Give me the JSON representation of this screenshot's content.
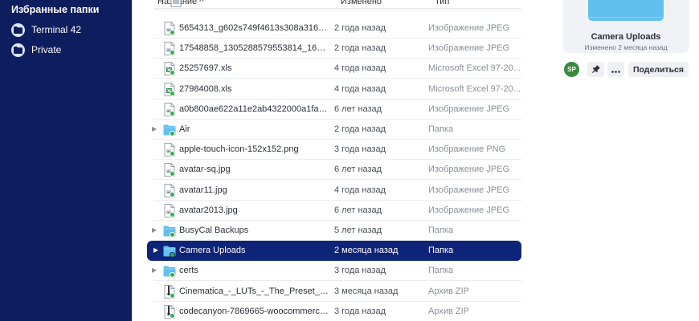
{
  "sidebar": {
    "title": "Избранные папки",
    "items": [
      {
        "label": "Terminal 42",
        "icon": "folder-icon"
      },
      {
        "label": "Private",
        "icon": "folder-icon"
      }
    ]
  },
  "list": {
    "columns": {
      "name": "Название ^",
      "modified": "Изменено",
      "type": "Тип"
    },
    "rows": [
      {
        "name": "5654313_g602s749f4613s308a3164j21...",
        "modified": "2 года назад",
        "type": "Изображение JPEG",
        "kind": "image",
        "chevron": false,
        "selected": false
      },
      {
        "name": "17548858_1305288579553814_161229...",
        "modified": "2 года назад",
        "type": "Изображение JPEG",
        "kind": "image",
        "chevron": false,
        "selected": false
      },
      {
        "name": "25257697.xls",
        "modified": "4 года назад",
        "type": "Microsoft Excel 97-20...",
        "kind": "excel",
        "chevron": false,
        "selected": false
      },
      {
        "name": "27984008.xls",
        "modified": "4 года назад",
        "type": "Microsoft Excel 97-20...",
        "kind": "excel",
        "chevron": false,
        "selected": false
      },
      {
        "name": "a0b800ae622a11e2ab4322000a1fa430...",
        "modified": "6 лет назад",
        "type": "Изображение JPEG",
        "kind": "image",
        "chevron": false,
        "selected": false
      },
      {
        "name": "Air",
        "modified": "2 года назад",
        "type": "Папка",
        "kind": "folder",
        "chevron": true,
        "selected": false
      },
      {
        "name": "apple-touch-icon-152x152.png",
        "modified": "3 года назад",
        "type": "Изображение PNG",
        "kind": "image",
        "chevron": false,
        "selected": false
      },
      {
        "name": "avatar-sq.jpg",
        "modified": "6 лет назад",
        "type": "Изображение JPEG",
        "kind": "image",
        "chevron": false,
        "selected": false
      },
      {
        "name": "avatar11.jpg",
        "modified": "4 года назад",
        "type": "Изображение JPEG",
        "kind": "image",
        "chevron": false,
        "selected": false
      },
      {
        "name": "avatar2013.jpg",
        "modified": "6 лет назад",
        "type": "Изображение JPEG",
        "kind": "image",
        "chevron": false,
        "selected": false
      },
      {
        "name": "BusyCal Backups",
        "modified": "5 лет назад",
        "type": "Папка",
        "kind": "folder",
        "chevron": true,
        "selected": false
      },
      {
        "name": "Camera Uploads",
        "modified": "2 месяца назад",
        "type": "Папка",
        "kind": "folder",
        "chevron": true,
        "selected": true
      },
      {
        "name": "certs",
        "modified": "3 года назад",
        "type": "Папка",
        "kind": "folder",
        "chevron": true,
        "selected": false
      },
      {
        "name": "Cinematica_-_LUTs_-_The_Preset_Facto...",
        "modified": "3 месяца назад",
        "type": "Архив ZIP",
        "kind": "zip",
        "chevron": false,
        "selected": false
      },
      {
        "name": "codecanyon-7869665-woocommerce-...",
        "modified": "3 года назад",
        "type": "Архив ZIP",
        "kind": "zip",
        "chevron": false,
        "selected": false
      }
    ]
  },
  "preview": {
    "title": "Camera Uploads",
    "subtitle": "Изменено 2 месяца назад",
    "folder_color": "#63bff0"
  },
  "actions": {
    "avatar": "SP",
    "avatar_color": "#3a8b3e",
    "pin_icon": "pin-icon",
    "more_icon": "more-icon",
    "share": "Поделиться"
  },
  "colors": {
    "sidebar_bg": "#0d1d5e",
    "selected_row": "#0e2478",
    "sync_dot": "#34b04a"
  }
}
